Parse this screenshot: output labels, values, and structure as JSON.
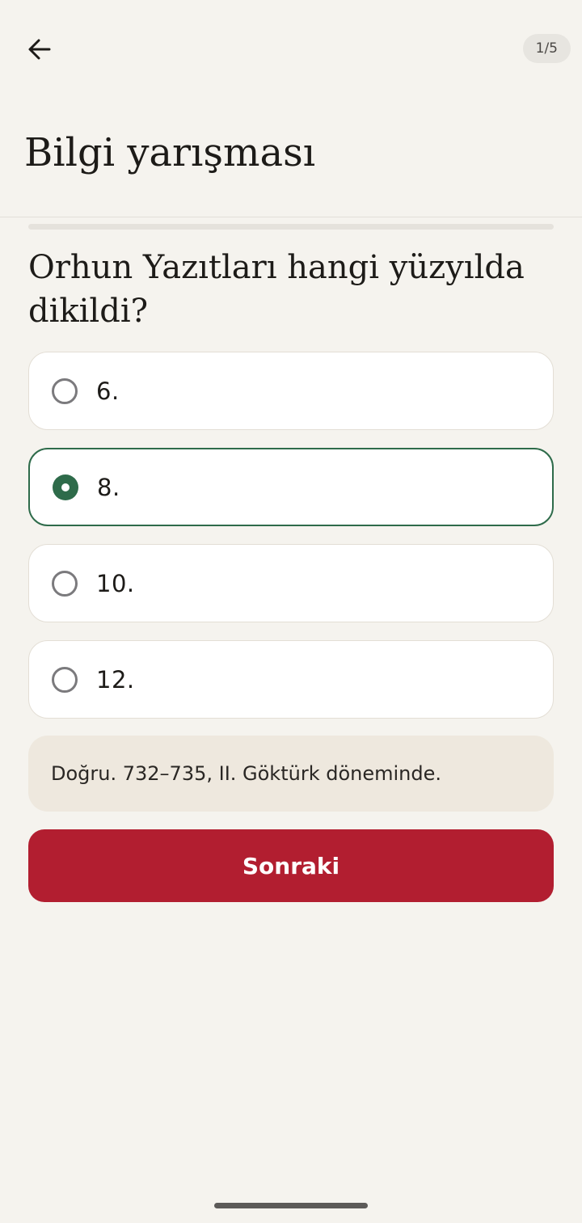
{
  "header": {
    "back_icon": "arrow-left-icon",
    "progress_label": "1/5",
    "title": "Bilgi yarışması"
  },
  "quiz": {
    "progress_fraction": 0.0,
    "question": "Orhun Yazıtları hangi yüzyılda dikildi?",
    "options": [
      {
        "label": "6.",
        "selected": false
      },
      {
        "label": "8.",
        "selected": true
      },
      {
        "label": "10.",
        "selected": false
      },
      {
        "label": "12.",
        "selected": false
      }
    ],
    "feedback": "Doğru. 732–735, II. Göktürk döneminde.",
    "next_label": "Sonraki"
  },
  "colors": {
    "background": "#f5f3ee",
    "accent_green": "#2e6b4a",
    "primary_red": "#b21e30",
    "feedback_bg": "#eee8de"
  }
}
